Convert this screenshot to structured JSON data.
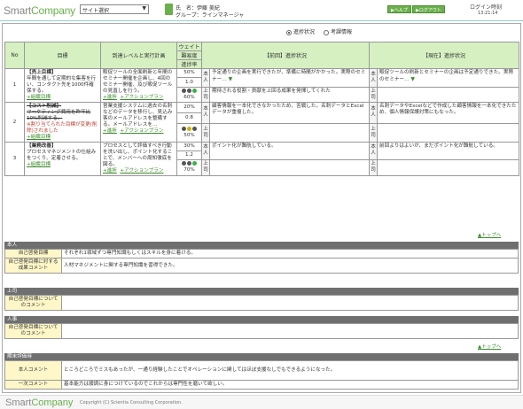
{
  "header": {
    "logo_prefix": "Smart",
    "logo_suffix": "Company",
    "site_select": "サイト選択",
    "name_label": "氏　名：伊藤 美紀",
    "group_label": "グループ：ラインマネージャ",
    "help_label": "▶ヘルプ",
    "logout_label": "▶ログアウト",
    "login_time_label": "ログイン時刻",
    "login_time_value": "13:21:14"
  },
  "tabs": [
    {
      "label": "進捗状況",
      "selected": true
    },
    {
      "label": "考課情報",
      "selected": false
    }
  ],
  "table": {
    "headers": {
      "no": "No",
      "goal": "目標",
      "plan": "到達レベルと実行計画",
      "weight": "ウェイト",
      "difficulty": "難易度",
      "progress": "進捗率",
      "prev": "【前回】進捗状況",
      "current": "【現在】進捗状況"
    },
    "rows": [
      {
        "no": "1",
        "goal_title": "【売上目標】",
        "goal_text": "年間を通して定期的な集客を行い、コンタクト先を1000件確保する。",
        "goal_link": "+組織目標",
        "plan_text": "販促ツールの全面刷新と年間のセミナー開催を企画し、4回のセミナー開催、及び販促ツールの見直しを行う。",
        "plan_link1": "+進捗",
        "plan_link2": "+アクションプラン",
        "weight": "50%",
        "difficulty": "1.0",
        "progress": "60%",
        "label_self": "本人",
        "label_boss": "上司",
        "prev_self": "予定通りの企画を実行できたが、準備に時間がかかった。実際のセミナー…",
        "prev_boss": "期待される役割・貢献を上回る成果を発揮してくれた",
        "cur_self": "販促ツールの刷新とセミナーの企画は予定通りできた。実際のセミナー…",
        "cur_boss": ""
      },
      {
        "no": "2",
        "goal_title": "【コスト削減】",
        "goal_struck": "マーケティング費用を昨年比10%削減する。",
        "goal_red": "※割り当てられた目標が変更(削除)されました",
        "goal_link": "+組織目標",
        "plan_text": "営業支援システムに過去の名刺などのデータを移行し、見込み客のメールアドレスを整備する。メールアドレスを…",
        "plan_link1": "+進捗",
        "plan_link2": "+アクションプラン",
        "weight": "20%",
        "difficulty": "0.8",
        "progress": "50%",
        "label_self": "本人",
        "label_boss": "上司",
        "prev_self": "顧客情報を一本化できなかったため、苦戦した。名刺データとExcelデータが重複した。",
        "prev_boss": "",
        "cur_self": "名刺データやExcelなどで作成した顧客情報を一本化できたため、個人情報保護対策にもなった。",
        "cur_boss": ""
      },
      {
        "no": "3",
        "goal_title": "【業務改善】",
        "goal_text": "プロセスマネジメントの仕組みをつくり、定着させる。",
        "goal_link": "+組織目標",
        "plan_text": "プロセスとして評価すべき行動を洗い出し、ポイント化することで、メンバーへの周知徹底を図る。",
        "plan_link1": "+進捗",
        "plan_link2": "+アクションプラン",
        "weight": "30%",
        "difficulty": "1.2",
        "progress": "70%",
        "label_self": "本人",
        "label_boss": "上司",
        "prev_self": "ポイント化が難航している。",
        "prev_boss": "",
        "cur_self": "前回よりはよいが、まだポイント化が難航している。",
        "cur_boss": ""
      }
    ],
    "to_top": "▲トップへ"
  },
  "comments": {
    "self_header": "本人",
    "self_rows": [
      {
        "label": "自己啓発目標",
        "value": "それぞれ1領域ずつ専門知識もしくはスキルを身に着ける。"
      },
      {
        "label": "自己啓発目標に対する成果コメント",
        "value": "人材マネジメントに関する専門知識を習得できた。"
      }
    ],
    "boss_header": "上司",
    "boss_rows": [
      {
        "label": "自己啓発目標についてのコメント",
        "value": ""
      }
    ],
    "hr_header": "人事",
    "hr_rows": [
      {
        "label": "自己啓発目標についてのコメント",
        "value": ""
      }
    ],
    "to_top": "▲トップへ",
    "final_header": "期末評価時",
    "final_rows": [
      {
        "label": "本人コメント",
        "value": "ところどころでミスもあったが、一通り経験したことでオペレーションに関してはほぼ支援なしでもできるようになった。"
      },
      {
        "label": "一次コメント",
        "value": "基本能力は順調に身につけているのでこれからは専門性を磨いて欲しい。"
      }
    ]
  },
  "footer": {
    "logo_prefix": "Smart",
    "logo_suffix": "Company",
    "copyright": "Copyright (C) Scientia Consulting Corporation."
  }
}
